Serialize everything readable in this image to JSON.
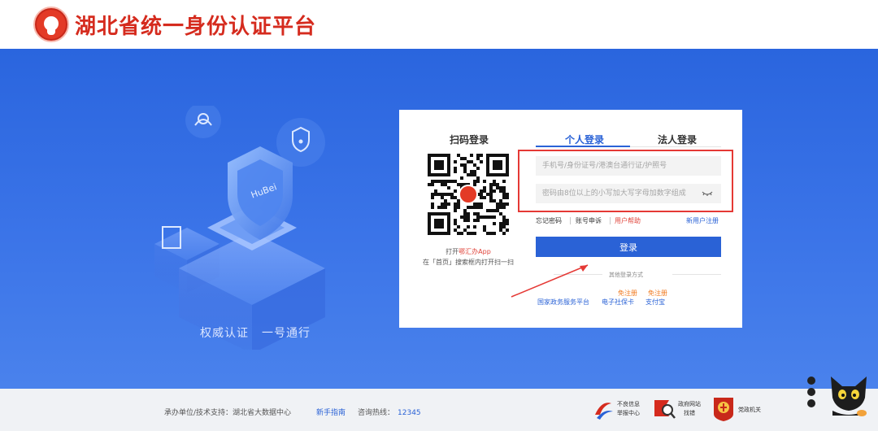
{
  "header": {
    "title": "湖北省统一身份认证平台"
  },
  "hero": {
    "slogan": [
      "权威认证",
      "一号通行"
    ]
  },
  "login": {
    "qr_title": "扫码登录",
    "qr_hint_prefix": "打开",
    "qr_hint_app": "鄂汇办App",
    "qr_hint_line2": "在「首页」搜索框内打开扫一扫",
    "tabs": [
      "个人登录",
      "法人登录"
    ],
    "account_placeholder": "手机号/身份证号/港澳台通行证/护照号",
    "password_placeholder": "密码由8位以上的小写加大写字母加数字组成",
    "links": {
      "forgot": "忘记密码",
      "appeal": "账号申诉",
      "help": "用户帮助",
      "register": "新用户注册"
    },
    "login_button": "登录",
    "other_methods": "其他登录方式",
    "alt_logins": [
      {
        "label": "国家政务服务平台",
        "tag": ""
      },
      {
        "label": "电子社保卡",
        "tag": "免注册"
      },
      {
        "label": "支付宝",
        "tag": "免注册"
      }
    ]
  },
  "footer": {
    "support": "承办单位/技术支持：湖北省大数据中心",
    "guide": "新手指南",
    "hotline_label": "咨询热线：",
    "hotline_number": "12345",
    "report_line1": "不良信息",
    "report_line2": "举报中心",
    "gov_line1": "政府网站",
    "gov_line2": "找错",
    "party_label": "党政机关"
  },
  "colors": {
    "brand_red": "#d52b1e",
    "primary_blue": "#2a62d6",
    "hero_blue": "#3b74e8",
    "accent_orange": "#f07a20"
  }
}
